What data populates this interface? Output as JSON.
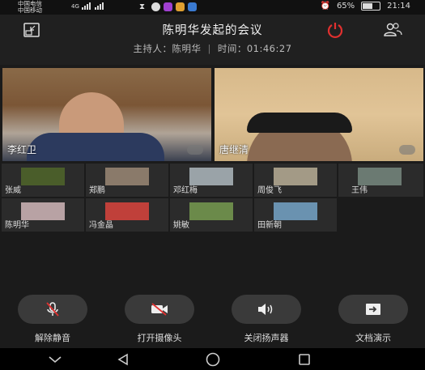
{
  "status": {
    "carrier1": "中国电信",
    "carrier2": "中国移动",
    "network1": "4G",
    "battery": "65%",
    "battery_level": 0.65,
    "time": "21:14"
  },
  "header": {
    "title": "陈明华发起的会议",
    "host_label": "主持人：",
    "host_name": "陈明华",
    "separator": "|",
    "time_label": "时间：",
    "duration": "01:46:27",
    "end_color": "#e0302f"
  },
  "videos": [
    {
      "name": "李红卫"
    },
    {
      "name": "唐继清"
    }
  ],
  "participants": [
    {
      "name": "张威",
      "thumb": "#4a5d2a"
    },
    {
      "name": "郑鹏",
      "thumb": "#8a7a6a"
    },
    {
      "name": "邓红梅",
      "thumb": "#9aa3a8"
    },
    {
      "name": "周俊飞",
      "thumb": "#a39a86"
    },
    {
      "name": "王伟",
      "thumb": "#6b7a72"
    },
    {
      "name": "陈明华",
      "thumb": "#b8a2a4"
    },
    {
      "name": "冯金晶",
      "thumb": "#c0403a"
    },
    {
      "name": "姚敏",
      "thumb": "#6b8a4a"
    },
    {
      "name": "田新朝",
      "thumb": "#6a92b0"
    }
  ],
  "controls": {
    "unmute": "解除静音",
    "camera": "打开摄像头",
    "speaker": "关闭扬声器",
    "share": "文档演示"
  }
}
